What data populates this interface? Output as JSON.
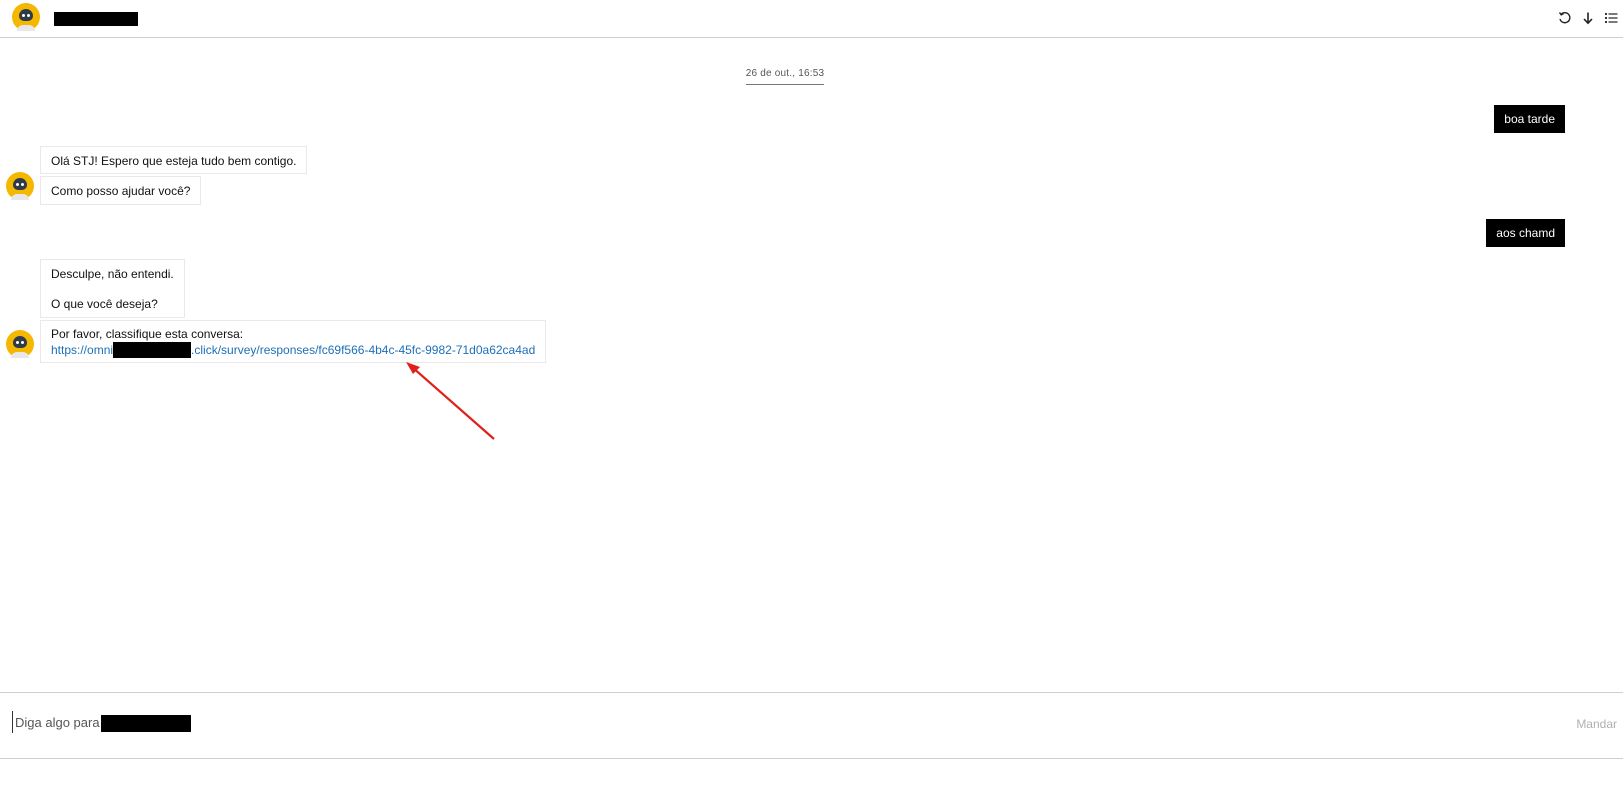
{
  "header": {
    "icons": [
      "refresh-icon",
      "download-icon",
      "list-icon"
    ]
  },
  "messages": {
    "date_separator": "26 de out., 16:53",
    "user_1": "boa tarde",
    "bot_1a": "Olá STJ! Espero que esteja tudo bem contigo.",
    "bot_1b": "Como posso ajudar você?",
    "user_2": "aos chamd",
    "bot_2_line1": "Desculpe, não entendi.",
    "bot_2_line2": "O que você deseja?",
    "bot_3_text": "Por favor, classifique esta conversa:",
    "bot_3_link_prefix": "https://omni",
    "bot_3_link_suffix": ".click/survey/responses/fc69f566-4b4c-45fc-9982-71d0a62ca4ad"
  },
  "composer": {
    "placeholder": "Diga algo para",
    "send_label": "Mandar"
  },
  "colors": {
    "brand": "#f5b800",
    "link": "#1d6fb8",
    "annotation_arrow": "#e0201b"
  }
}
